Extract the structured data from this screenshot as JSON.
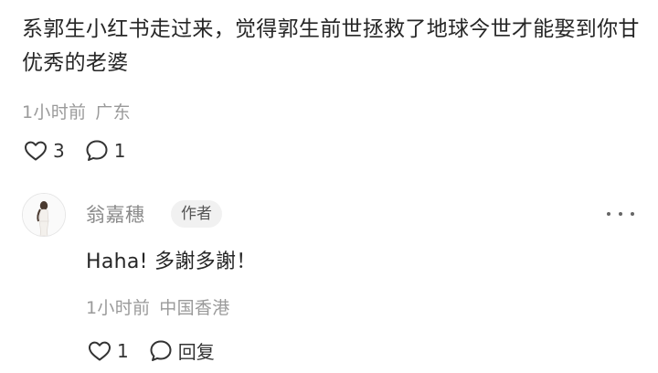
{
  "comment": {
    "text": "系郭生小红书走过来，觉得郭生前世拯救了地球今世才能娶到你甘优秀的老婆",
    "time": "1小时前",
    "location": "广东",
    "likes": "3",
    "replies": "1"
  },
  "reply": {
    "author": "翁嘉穗",
    "badge": "作者",
    "text": "Haha! 多謝多謝！",
    "time": "1小时前",
    "location": "中国香港",
    "likes": "1",
    "reply_label": "回复"
  },
  "icons": {
    "like": "heart-outline-icon",
    "comment": "speech-bubble-icon",
    "more": "more-horizontal-icon"
  },
  "colors": {
    "meta_text": "#9a9a9a",
    "badge_bg": "#f1f1f1"
  }
}
